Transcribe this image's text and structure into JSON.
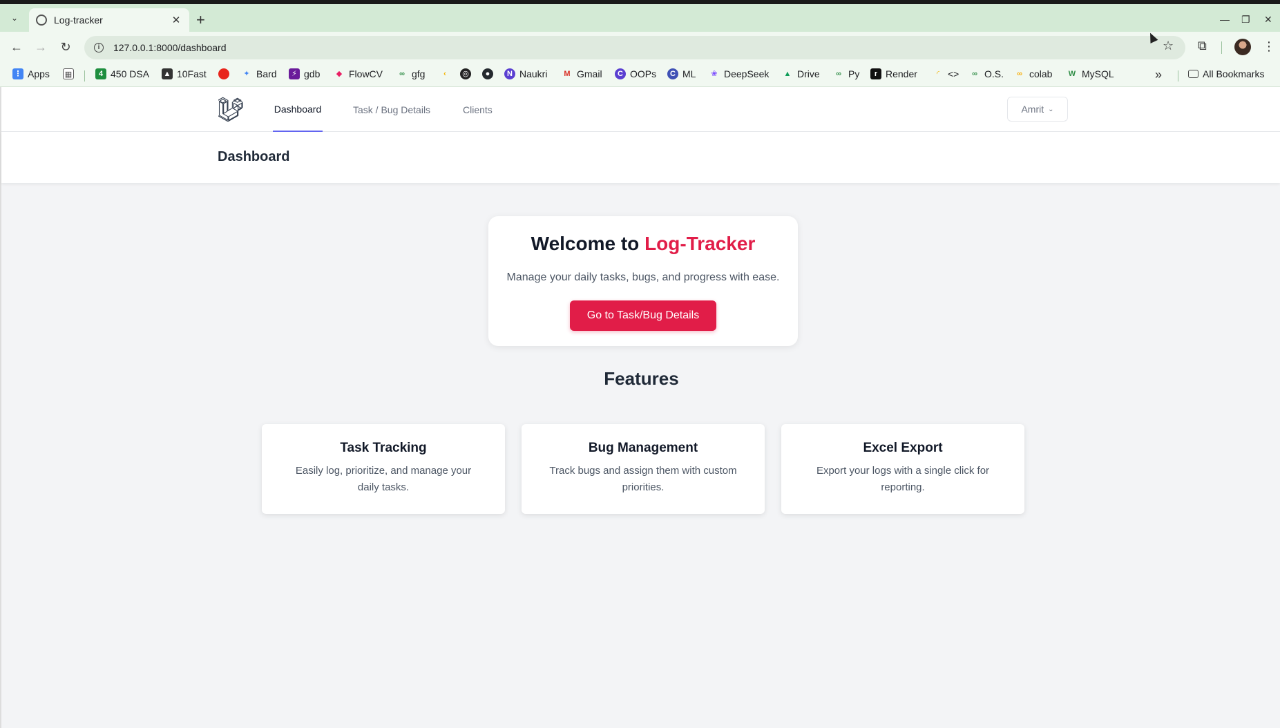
{
  "browser": {
    "tab_title": "Log-tracker",
    "url": "127.0.0.1:8000/dashboard",
    "bookmarks": [
      {
        "label": "Apps",
        "color": "#4285f4"
      },
      {
        "label": "",
        "color": "#555"
      },
      {
        "label": "450 DSA",
        "color": "#1e8e3e"
      },
      {
        "label": "10Fast",
        "color": "#333"
      },
      {
        "label": "",
        "color": "#e8251b"
      },
      {
        "label": "Bard",
        "color": "#4285f4"
      },
      {
        "label": "gdb",
        "color": "#6a1b9a"
      },
      {
        "label": "FlowCV",
        "color": "#e91e63"
      },
      {
        "label": "gfg",
        "color": "#2f8d46"
      },
      {
        "label": "",
        "color": "#f4b400"
      },
      {
        "label": "",
        "color": "#222"
      },
      {
        "label": "",
        "color": "#24292e"
      },
      {
        "label": "Naukri",
        "color": "#5a3fd1"
      },
      {
        "label": "Gmail",
        "color": "#d93025"
      },
      {
        "label": "OOPs",
        "color": "#5a3fd1"
      },
      {
        "label": "ML",
        "color": "#3f51b5"
      },
      {
        "label": "DeepSeek",
        "color": "#7c4dff"
      },
      {
        "label": "Drive",
        "color": "#0f9d58"
      },
      {
        "label": "Py",
        "color": "#2f8d46"
      },
      {
        "label": "Render",
        "color": "#111"
      },
      {
        "label": "<>",
        "color": "#f4b400"
      },
      {
        "label": "O.S.",
        "color": "#2f8d46"
      },
      {
        "label": "colab",
        "color": "#f9ab00"
      },
      {
        "label": "MySQL",
        "color": "#2f8d46"
      }
    ],
    "all_bookmarks": "All Bookmarks"
  },
  "nav": {
    "links": [
      "Dashboard",
      "Task / Bug Details",
      "Clients"
    ],
    "user": "Amrit"
  },
  "header": {
    "title": "Dashboard"
  },
  "welcome": {
    "title_prefix": "Welcome to ",
    "title_brand": "Log-Tracker",
    "subtitle": "Manage your daily tasks, bugs, and progress with ease.",
    "cta": "Go to Task/Bug Details"
  },
  "features": {
    "title": "Features",
    "cards": [
      {
        "title": "Task Tracking",
        "desc": "Easily log, prioritize, and manage your daily tasks."
      },
      {
        "title": "Bug Management",
        "desc": "Track bugs and assign them with custom priorities."
      },
      {
        "title": "Excel Export",
        "desc": "Export your logs with a single click for reporting."
      }
    ]
  },
  "colors": {
    "brand": "#e11d48",
    "active_tab": "#6366f1"
  }
}
